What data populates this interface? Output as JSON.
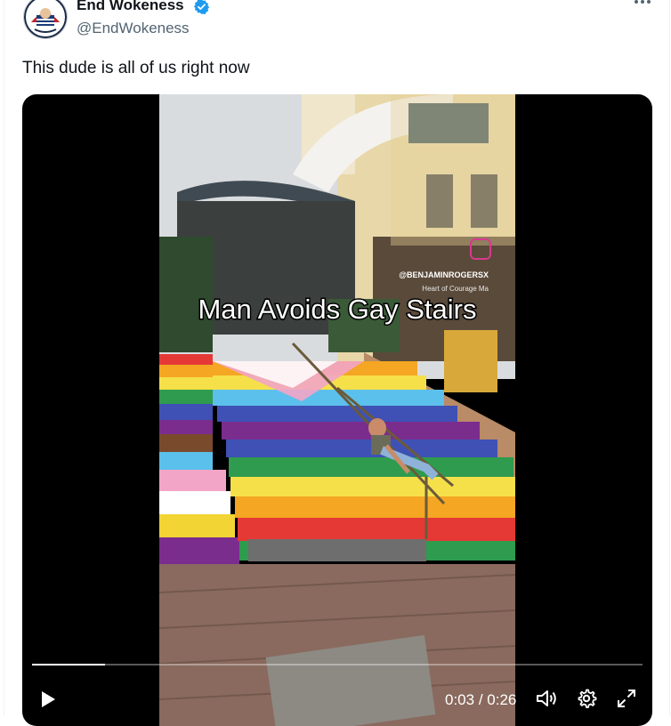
{
  "author": {
    "display_name": "End Wokeness",
    "handle": "@EndWokeness",
    "verified": true,
    "avatar_icon": "avatar-logo-icon"
  },
  "tweet": {
    "text": "This dude is all of us right now"
  },
  "video": {
    "caption": "Man Avoids Gay Stairs",
    "watermark": "@BENJAMINROGERSX",
    "sign_text": "Heart of Courage Ma",
    "current_time": "0:03",
    "separator": "/",
    "duration": "0:26",
    "progress_fraction": 0.12
  },
  "controls": {
    "play_icon": "play-icon",
    "volume_icon": "volume-icon",
    "settings_icon": "gear-icon",
    "fullscreen_icon": "fullscreen-icon",
    "more_icon": "more-icon"
  },
  "colors": {
    "verified_blue": "#1d9bf0",
    "text_primary": "#0f1419",
    "text_secondary": "#536471"
  }
}
